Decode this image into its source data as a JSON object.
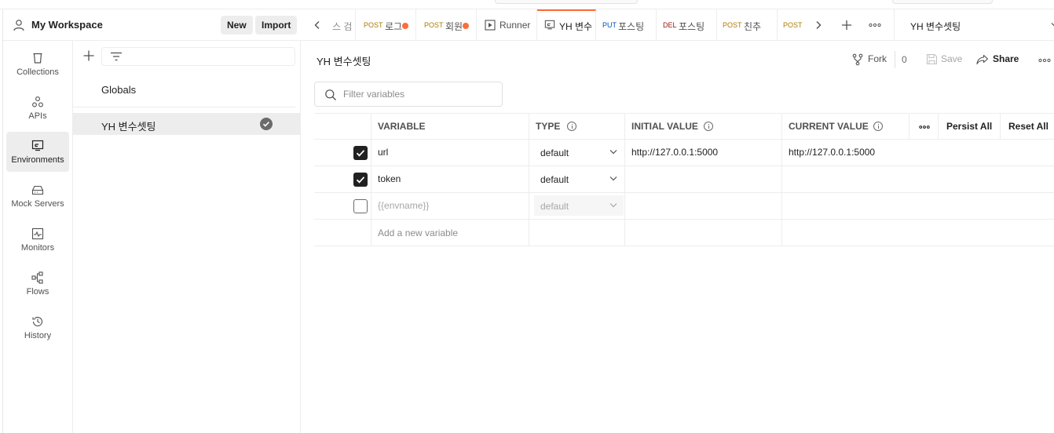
{
  "workspace": {
    "title": "My Workspace",
    "new_label": "New",
    "import_label": "Import"
  },
  "nav": [
    {
      "label": "Collections",
      "icon": "trash-can-icon"
    },
    {
      "label": "APIs",
      "icon": "apis-icon"
    },
    {
      "label": "Environments",
      "icon": "environments-icon",
      "active": true
    },
    {
      "label": "Mock Servers",
      "icon": "server-icon"
    },
    {
      "label": "Monitors",
      "icon": "monitor-icon"
    },
    {
      "label": "Flows",
      "icon": "flows-icon"
    },
    {
      "label": "History",
      "icon": "history-icon"
    }
  ],
  "env_list": {
    "globals": "Globals",
    "selected": "YH 변수셋팅"
  },
  "tabs": [
    {
      "method": "",
      "name": "스 검"
    },
    {
      "method": "POST",
      "name": "로그",
      "dirty": true
    },
    {
      "method": "POST",
      "name": "회원",
      "dirty": true
    },
    {
      "method": "",
      "name": "Runner"
    },
    {
      "method": "",
      "name": "YH 변수",
      "active": true
    },
    {
      "method": "PUT",
      "name": "포스팅"
    },
    {
      "method": "DEL",
      "name": "포스팅"
    },
    {
      "method": "POST",
      "name": "친추"
    },
    {
      "method": "POST",
      "name": ""
    }
  ],
  "env_selector": "YH 변수셋팅",
  "main": {
    "title": "YH 변수셋팅",
    "fork_label": "Fork",
    "fork_count": "0",
    "save_label": "Save",
    "share_label": "Share",
    "search_placeholder": "Filter variables"
  },
  "table": {
    "headers": {
      "variable": "VARIABLE",
      "type": "TYPE",
      "initial": "INITIAL VALUE",
      "current": "CURRENT VALUE",
      "persist": "Persist All",
      "reset": "Reset All"
    },
    "rows": [
      {
        "enabled": true,
        "variable": "url",
        "type": "default",
        "initial": "http://127.0.0.1:5000",
        "current": "http://127.0.0.1:5000"
      },
      {
        "enabled": true,
        "variable": "token",
        "type": "default",
        "initial": "",
        "current": ""
      },
      {
        "enabled": false,
        "variable": "{{envname}}",
        "type": "default",
        "initial": "",
        "current": ""
      }
    ],
    "add_placeholder": "Add a new variable"
  },
  "colors": {
    "accent": "#ff6c37",
    "post": "#ad7a03",
    "put": "#0053b8",
    "del": "#8e1a10"
  }
}
